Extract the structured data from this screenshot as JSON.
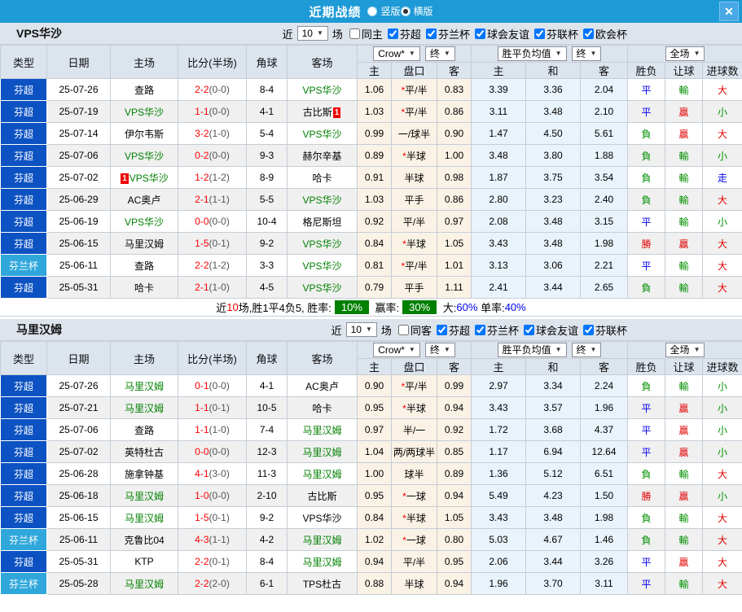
{
  "titlebar": {
    "title": "近期战绩",
    "radios": [
      {
        "label": "竖版",
        "selected": false
      },
      {
        "label": "横版",
        "selected": true
      }
    ],
    "close_icon": "✕"
  },
  "colors": {
    "titlebar_bg": "#1E9AD6",
    "league_badge_blue": "#0D52C2",
    "cup_badge_cyan": "#2FA7DB",
    "team_highlight_green": "#008000",
    "score_red": "#FF0000",
    "result_red": "#E10000",
    "result_green": "#009000",
    "result_blue": "#0000EE",
    "odds_col_bg": "#FAF2E5",
    "avg_col_bg": "#E9F3FB",
    "summary_badge_green": "#008000"
  },
  "cup_name": "芬兰杯",
  "result_colors": {
    "勝": "red",
    "胜": "red",
    "平": "blue",
    "負": "green",
    "贏": "red",
    "輸": "green",
    "大": "red",
    "小": "green",
    "走": "blue"
  },
  "table_header": {
    "main_cols": [
      "类型",
      "日期",
      "主场",
      "比分(半场)",
      "角球",
      "客场"
    ],
    "group1": {
      "dropdowns": [
        "Crow*",
        "终"
      ],
      "subs": [
        "主",
        "盘口",
        "客"
      ]
    },
    "group2": {
      "dropdowns": [
        "胜平负均值",
        "终"
      ],
      "subs": [
        "主",
        "和",
        "客"
      ]
    },
    "group3": {
      "dropdowns": [
        "全场"
      ],
      "subs": [
        "胜负",
        "让球",
        "进球数"
      ]
    }
  },
  "sections": [
    {
      "team": "VPS华沙",
      "filter": {
        "near_label": "近",
        "count": "10",
        "games_label": "场",
        "same_label": "同主",
        "same_checked": false,
        "leagues": [
          "芬超",
          "芬兰杯",
          "球会友谊",
          "芬联杯",
          "欧会杯"
        ]
      },
      "rows": [
        {
          "type": "芬超",
          "date": "25-07-26",
          "home": "查路",
          "score": "2-2",
          "half": "(0-0)",
          "corner": "8-4",
          "away": "VPS华沙",
          "away_green": true,
          "odds": [
            "1.06",
            "*平/半",
            "0.83"
          ],
          "avg": [
            "3.39",
            "3.36",
            "2.04"
          ],
          "res": [
            "平",
            "輸",
            "大"
          ]
        },
        {
          "type": "芬超",
          "date": "25-07-19",
          "home": "VPS华沙",
          "home_green": true,
          "score": "1-1",
          "half": "(0-0)",
          "corner": "4-1",
          "away": "古比斯",
          "away_card": "1",
          "odds": [
            "1.03",
            "*平/半",
            "0.86"
          ],
          "avg": [
            "3.11",
            "3.48",
            "2.10"
          ],
          "res": [
            "平",
            "贏",
            "小"
          ]
        },
        {
          "type": "芬超",
          "date": "25-07-14",
          "home": "伊尔韦斯",
          "score": "3-2",
          "half": "(1-0)",
          "corner": "5-4",
          "away": "VPS华沙",
          "away_green": true,
          "odds": [
            "0.99",
            "一/球半",
            "0.90"
          ],
          "avg": [
            "1.47",
            "4.50",
            "5.61"
          ],
          "res": [
            "負",
            "贏",
            "大"
          ]
        },
        {
          "type": "芬超",
          "date": "25-07-06",
          "home": "VPS华沙",
          "home_green": true,
          "score": "0-2",
          "half": "(0-0)",
          "corner": "9-3",
          "away": "赫尔辛基",
          "odds": [
            "0.89",
            "*半球",
            "1.00"
          ],
          "avg": [
            "3.48",
            "3.80",
            "1.88"
          ],
          "res": [
            "負",
            "輸",
            "小"
          ]
        },
        {
          "type": "芬超",
          "date": "25-07-02",
          "home": "VPS华沙",
          "home_green": true,
          "home_card": "1",
          "score": "1-2",
          "half": "(1-2)",
          "corner": "8-9",
          "away": "哈卡",
          "odds": [
            "0.91",
            "半球",
            "0.98"
          ],
          "avg": [
            "1.87",
            "3.75",
            "3.54"
          ],
          "res": [
            "負",
            "輸",
            "走"
          ]
        },
        {
          "type": "芬超",
          "date": "25-06-29",
          "home": "AC奥卢",
          "score": "2-1",
          "half": "(1-1)",
          "corner": "5-5",
          "away": "VPS华沙",
          "away_green": true,
          "odds": [
            "1.03",
            "平手",
            "0.86"
          ],
          "avg": [
            "2.80",
            "3.23",
            "2.40"
          ],
          "res": [
            "負",
            "輸",
            "大"
          ]
        },
        {
          "type": "芬超",
          "date": "25-06-19",
          "home": "VPS华沙",
          "home_green": true,
          "score": "0-0",
          "half": "(0-0)",
          "corner": "10-4",
          "away": "格尼斯坦",
          "odds": [
            "0.92",
            "平/半",
            "0.97"
          ],
          "avg": [
            "2.08",
            "3.48",
            "3.15"
          ],
          "res": [
            "平",
            "輸",
            "小"
          ]
        },
        {
          "type": "芬超",
          "date": "25-06-15",
          "home": "马里汉姆",
          "score": "1-5",
          "half": "(0-1)",
          "corner": "9-2",
          "away": "VPS华沙",
          "away_green": true,
          "odds": [
            "0.84",
            "*半球",
            "1.05"
          ],
          "avg": [
            "3.43",
            "3.48",
            "1.98"
          ],
          "res": [
            "勝",
            "贏",
            "大"
          ]
        },
        {
          "type": "芬兰杯",
          "date": "25-06-11",
          "home": "查路",
          "score": "2-2",
          "half": "(1-2)",
          "corner": "3-3",
          "away": "VPS华沙",
          "away_green": true,
          "odds": [
            "0.81",
            "*平/半",
            "1.01"
          ],
          "avg": [
            "3.13",
            "3.06",
            "2.21"
          ],
          "res": [
            "平",
            "輸",
            "大"
          ]
        },
        {
          "type": "芬超",
          "date": "25-05-31",
          "home": "哈卡",
          "score": "2-1",
          "half": "(1-0)",
          "corner": "4-5",
          "away": "VPS华沙",
          "away_green": true,
          "odds": [
            "0.79",
            "平手",
            "1.11"
          ],
          "avg": [
            "2.41",
            "3.44",
            "2.65"
          ],
          "res": [
            "負",
            "輸",
            "大"
          ]
        }
      ],
      "summary": [
        {
          "text": "近",
          "c": "k"
        },
        {
          "text": "10",
          "c": "r"
        },
        {
          "text": "场,胜1平4负5, 胜率:",
          "c": "k"
        },
        {
          "text": "10%",
          "c": "gb"
        },
        {
          "text": " 赢率:",
          "c": "k"
        },
        {
          "text": "30%",
          "c": "gb"
        },
        {
          "text": " 大:",
          "c": "k"
        },
        {
          "text": "60%",
          "c": "b"
        },
        {
          "text": " 单率:",
          "c": "k"
        },
        {
          "text": "40%",
          "c": "b"
        }
      ]
    },
    {
      "team": "马里汉姆",
      "filter": {
        "near_label": "近",
        "count": "10",
        "games_label": "场",
        "same_label": "同客",
        "same_checked": false,
        "leagues": [
          "芬超",
          "芬兰杯",
          "球会友谊",
          "芬联杯"
        ]
      },
      "rows": [
        {
          "type": "芬超",
          "date": "25-07-26",
          "home": "马里汉姆",
          "home_green": true,
          "score": "0-1",
          "half": "(0-0)",
          "corner": "4-1",
          "away": "AC奥卢",
          "odds": [
            "0.90",
            "*平/半",
            "0.99"
          ],
          "avg": [
            "2.97",
            "3.34",
            "2.24"
          ],
          "res": [
            "負",
            "輸",
            "小"
          ]
        },
        {
          "type": "芬超",
          "date": "25-07-21",
          "home": "马里汉姆",
          "home_green": true,
          "score": "1-1",
          "half": "(0-1)",
          "corner": "10-5",
          "away": "哈卡",
          "odds": [
            "0.95",
            "*半球",
            "0.94"
          ],
          "avg": [
            "3.43",
            "3.57",
            "1.96"
          ],
          "res": [
            "平",
            "贏",
            "小"
          ]
        },
        {
          "type": "芬超",
          "date": "25-07-06",
          "home": "查路",
          "score": "1-1",
          "half": "(1-0)",
          "corner": "7-4",
          "away": "马里汉姆",
          "away_green": true,
          "odds": [
            "0.97",
            "半/一",
            "0.92"
          ],
          "avg": [
            "1.72",
            "3.68",
            "4.37"
          ],
          "res": [
            "平",
            "贏",
            "小"
          ]
        },
        {
          "type": "芬超",
          "date": "25-07-02",
          "home": "英特杜古",
          "score": "0-0",
          "half": "(0-0)",
          "corner": "12-3",
          "away": "马里汉姆",
          "away_green": true,
          "odds": [
            "1.04",
            "两/两球半",
            "0.85"
          ],
          "avg": [
            "1.17",
            "6.94",
            "12.64"
          ],
          "res": [
            "平",
            "贏",
            "小"
          ]
        },
        {
          "type": "芬超",
          "date": "25-06-28",
          "home": "施拿钟基",
          "score": "4-1",
          "half": "(3-0)",
          "corner": "11-3",
          "away": "马里汉姆",
          "away_green": true,
          "odds": [
            "1.00",
            "球半",
            "0.89"
          ],
          "avg": [
            "1.36",
            "5.12",
            "6.51"
          ],
          "res": [
            "負",
            "輸",
            "大"
          ]
        },
        {
          "type": "芬超",
          "date": "25-06-18",
          "home": "马里汉姆",
          "home_green": true,
          "score": "1-0",
          "half": "(0-0)",
          "corner": "2-10",
          "away": "古比斯",
          "odds": [
            "0.95",
            "*一球",
            "0.94"
          ],
          "avg": [
            "5.49",
            "4.23",
            "1.50"
          ],
          "res": [
            "勝",
            "贏",
            "小"
          ]
        },
        {
          "type": "芬超",
          "date": "25-06-15",
          "home": "马里汉姆",
          "home_green": true,
          "score": "1-5",
          "half": "(0-1)",
          "corner": "9-2",
          "away": "VPS华沙",
          "odds": [
            "0.84",
            "*半球",
            "1.05"
          ],
          "avg": [
            "3.43",
            "3.48",
            "1.98"
          ],
          "res": [
            "負",
            "輸",
            "大"
          ]
        },
        {
          "type": "芬兰杯",
          "date": "25-06-11",
          "home": "克鲁比04",
          "score": "4-3",
          "half": "(1-1)",
          "corner": "4-2",
          "away": "马里汉姆",
          "away_green": true,
          "odds": [
            "1.02",
            "*一球",
            "0.80"
          ],
          "avg": [
            "5.03",
            "4.67",
            "1.46"
          ],
          "res": [
            "負",
            "輸",
            "大"
          ]
        },
        {
          "type": "芬超",
          "date": "25-05-31",
          "home": "KTP",
          "score": "2-2",
          "half": "(0-1)",
          "corner": "8-4",
          "away": "马里汉姆",
          "away_green": true,
          "odds": [
            "0.94",
            "平/半",
            "0.95"
          ],
          "avg": [
            "2.06",
            "3.44",
            "3.26"
          ],
          "res": [
            "平",
            "贏",
            "大"
          ]
        },
        {
          "type": "芬兰杯",
          "date": "25-05-28",
          "home": "马里汉姆",
          "home_green": true,
          "score": "2-2",
          "half": "(2-0)",
          "corner": "6-1",
          "away": "TPS杜古",
          "odds": [
            "0.88",
            "半球",
            "0.94"
          ],
          "avg": [
            "1.96",
            "3.70",
            "3.11"
          ],
          "res": [
            "平",
            "輸",
            "大"
          ]
        }
      ],
      "summary": null
    }
  ]
}
